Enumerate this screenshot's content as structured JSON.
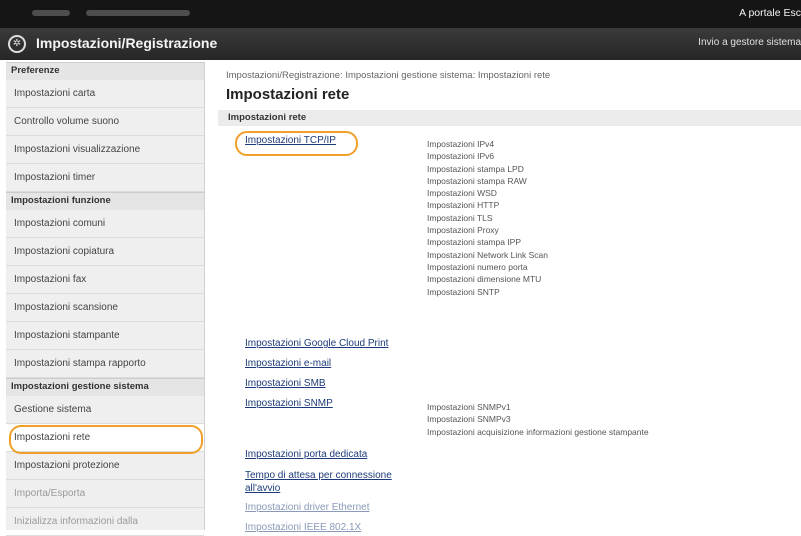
{
  "topbar": {
    "right_text": "A portale  Esc"
  },
  "titlebar": {
    "title": "Impostazioni/Registrazione",
    "right_text": "Invio a gestore sistema"
  },
  "sidebar": {
    "groups": [
      {
        "title": "Preferenze",
        "items": [
          "Impostazioni carta",
          "Controllo volume suono",
          "Impostazioni visualizzazione",
          "Impostazioni timer"
        ]
      },
      {
        "title": "Impostazioni funzione",
        "items": [
          "Impostazioni comuni",
          "Impostazioni copiatura",
          "Impostazioni fax",
          "Impostazioni scansione",
          "Impostazioni stampante",
          "Impostazioni stampa rapporto"
        ]
      },
      {
        "title": "Impostazioni gestione sistema",
        "items": [
          "Gestione sistema",
          "Impostazioni rete",
          "Impostazioni protezione",
          "Importa/Esporta",
          "Inizializza informazioni dalla"
        ]
      }
    ]
  },
  "main": {
    "breadcrumb": "Impostazioni/Registrazione: Impostazioni gestione sistema: Impostazioni rete",
    "title": "Impostazioni rete",
    "section": "Impostazioni rete",
    "links": [
      "Impostazioni TCP/IP",
      "Impostazioni Google Cloud Print",
      "Impostazioni e-mail",
      "Impostazioni SMB",
      "Impostazioni SNMP",
      "Impostazioni porta dedicata",
      "Tempo di attesa per connessione all'avvio",
      "Impostazioni driver Ethernet",
      "Impostazioni IEEE 802.1X"
    ],
    "tcpip_sub": [
      "Impostazioni IPv4",
      "Impostazioni IPv6",
      "Impostazioni stampa LPD",
      "Impostazioni stampa RAW",
      "Impostazioni WSD",
      "Impostazioni HTTP",
      "Impostazioni TLS",
      "Impostazioni Proxy",
      "Impostazioni stampa IPP",
      "Impostazioni Network Link Scan",
      "Impostazioni numero porta",
      "Impostazioni dimensione MTU",
      "Impostazioni SNTP"
    ],
    "snmp_sub": [
      "Impostazioni SNMPv1",
      "Impostazioni SNMPv3",
      "Impostazioni acquisizione informazioni gestione stampante"
    ]
  },
  "colors": {
    "highlight": "#f0a028",
    "link": "#1d3b7a"
  }
}
